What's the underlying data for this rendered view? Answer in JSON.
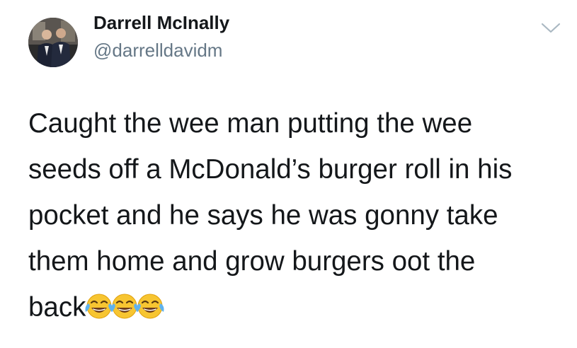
{
  "user": {
    "display_name": "Darrell McInally",
    "handle": "@darrelldavidm",
    "avatar_icon": "profile-photo"
  },
  "menu": {
    "icon": "chevron-down-icon"
  },
  "tweet": {
    "lines": [
      "Caught the wee man putting the wee",
      "seeds off a McDonald’s burger roll in his",
      "pocket and he says he was gonny take",
      "them home and grow burgers oot the",
      "back"
    ],
    "emoji": [
      "😂",
      "😂",
      "😂"
    ],
    "emoji_icon": "tears-of-joy-emoji-icon"
  },
  "colors": {
    "text": "#14171a",
    "secondary": "#657786",
    "caret": "#aab8c2"
  }
}
